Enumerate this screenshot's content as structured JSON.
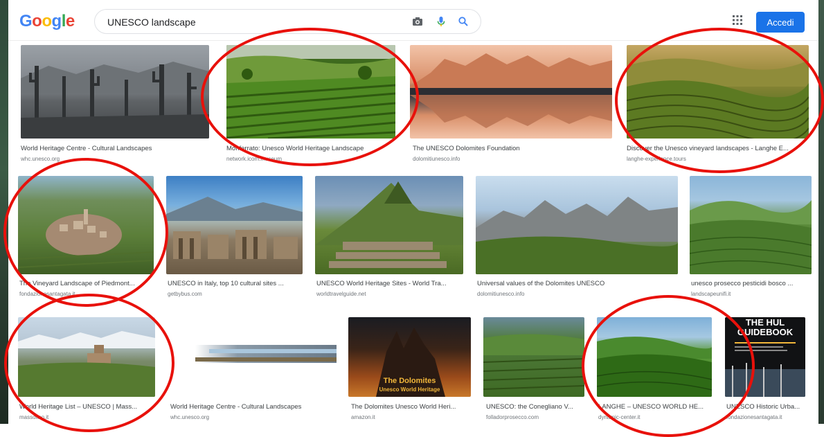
{
  "logo": {
    "letters": [
      "G",
      "o",
      "o",
      "g",
      "l",
      "e"
    ],
    "colors": [
      "#4285f4",
      "#ea4335",
      "#fbbc05",
      "#4285f4",
      "#34a853",
      "#ea4335"
    ]
  },
  "search": {
    "value": "UNESCO landscape"
  },
  "header": {
    "signin_label": "Accedi",
    "signin_color": "#1a73e8"
  },
  "icons": {
    "camera": "camera-icon",
    "mic": "microphone-icon",
    "search": "search-icon",
    "apps": "apps-grid-icon"
  },
  "annotation_color": "#e8110b",
  "results": [
    {
      "title": "World Heritage Centre - Cultural Landscapes",
      "source": "whc.unesco.org"
    },
    {
      "title": "Monferrato: Unesco World Heritage Landscape",
      "source": "network.icom.museum"
    },
    {
      "title": "The UNESCO Dolomites Foundation",
      "source": "dolomitiunesco.info"
    },
    {
      "title": "Discover the Unesco vineyard landscapes - Langhe E...",
      "source": "langhe-experience.tours"
    },
    {
      "title": "The Vineyard Landscape of Piedmont...",
      "source": "fondazionesantagata.it"
    },
    {
      "title": "UNESCO in Italy, top 10 cultural sites ...",
      "source": "getbybus.com"
    },
    {
      "title": "UNESCO World Heritage Sites - World Tra...",
      "source": "worldtravelguide.net"
    },
    {
      "title": "Universal values of the Dolomites UNESCO",
      "source": "dolomitiunesco.info"
    },
    {
      "title": "unesco prosecco pesticidi bosco ...",
      "source": "landscapeunifi.it"
    },
    {
      "title": "World Heritage List – UNESCO | Mass...",
      "source": "massolino.it"
    },
    {
      "title": "World Heritage Centre - Cultural Landscapes",
      "source": "whc.unesco.org"
    },
    {
      "title": "The Dolomites Unesco World Heri...",
      "source": "amazon.it"
    },
    {
      "title": "UNESCO: the Conegliano V...",
      "source": "folladorprosecco.com"
    },
    {
      "title": "LANGHE – UNESCO WORLD HE...",
      "source": "dynamic-center.it"
    },
    {
      "title": "UNESCO Historic Urba...",
      "source": "fondazionesantagata.it"
    }
  ],
  "image_text": {
    "dolomites_book_title": "The Dolomites",
    "dolomites_book_subtitle": "Unesco World Heritage",
    "hul_title_line1": "THE HUL",
    "hul_title_line2": "GUIDEBOOK"
  }
}
